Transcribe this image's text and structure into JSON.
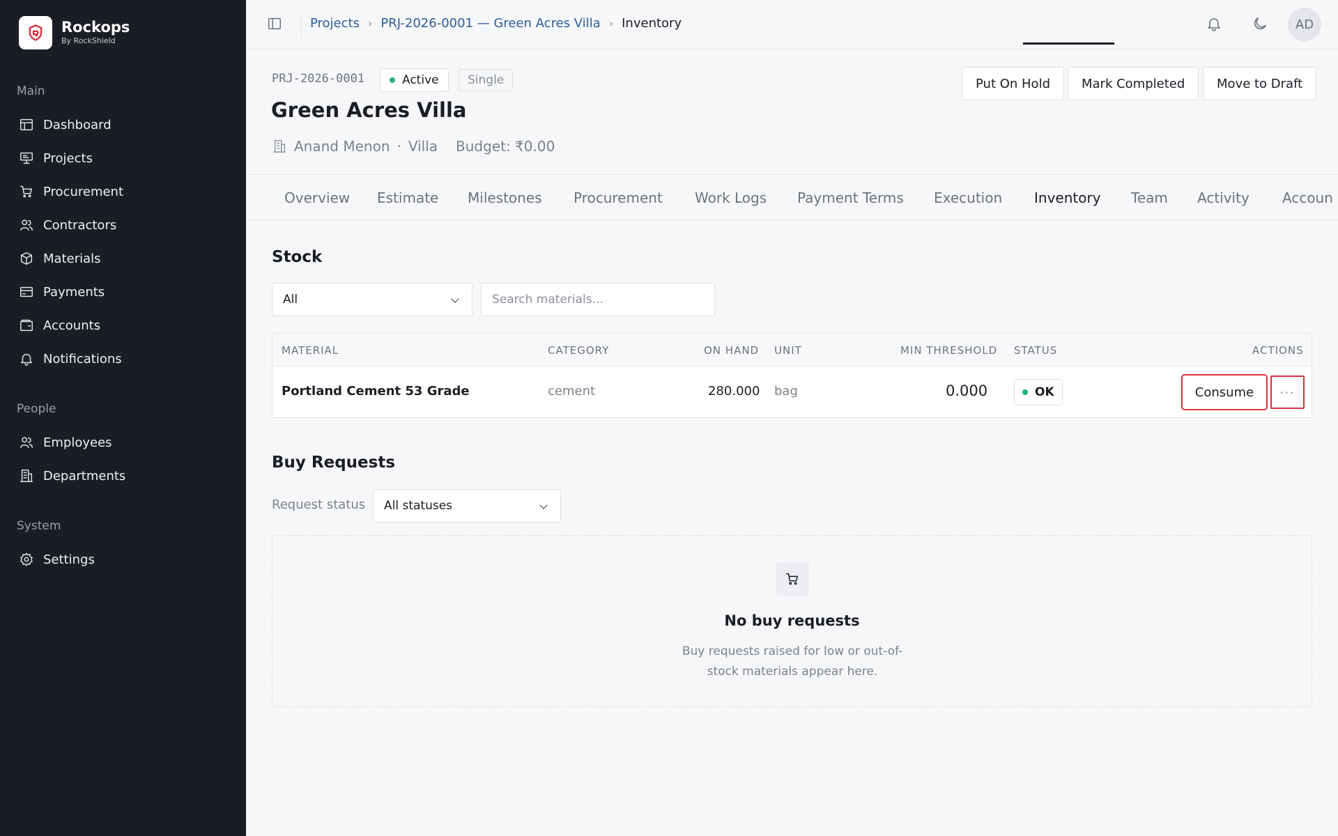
{
  "brand": {
    "name": "Rockops",
    "sub": "By RockShield"
  },
  "sidebar": {
    "sections": [
      {
        "label": "Main"
      },
      {
        "label": "People"
      },
      {
        "label": "System"
      }
    ],
    "items": [
      {
        "label": "Dashboard",
        "icon": "layout-icon"
      },
      {
        "label": "Projects",
        "icon": "presentation-icon"
      },
      {
        "label": "Procurement",
        "icon": "cart-icon"
      },
      {
        "label": "Contractors",
        "icon": "users-icon"
      },
      {
        "label": "Materials",
        "icon": "box-icon"
      },
      {
        "label": "Payments",
        "icon": "card-icon"
      },
      {
        "label": "Accounts",
        "icon": "wallet-icon"
      },
      {
        "label": "Notifications",
        "icon": "bell-icon"
      },
      {
        "label": "Employees",
        "icon": "users-icon"
      },
      {
        "label": "Departments",
        "icon": "building-icon"
      },
      {
        "label": "Settings",
        "icon": "gear-icon"
      }
    ]
  },
  "topbar": {
    "breadcrumb": [
      "Projects",
      "PRJ-2026-0001 — Green Acres Villa",
      "Inventory"
    ],
    "avatar": "AD"
  },
  "project": {
    "code": "PRJ-2026-0001",
    "status": "Active",
    "type": "Single",
    "title": "Green Acres Villa",
    "client": "Anand Menon",
    "category": "Villa",
    "budget": "Budget: ₹0.00",
    "actions": [
      "Put On Hold",
      "Mark Completed",
      "Move to Draft"
    ]
  },
  "tabs": [
    "Overview",
    "Estimate",
    "Milestones",
    "Procurement",
    "Work Logs",
    "Payment Terms",
    "Execution",
    "Inventory",
    "Team",
    "Activity",
    "Accoun"
  ],
  "active_tab": "Inventory",
  "stock": {
    "title": "Stock",
    "filter_value": "All",
    "search_placeholder": "Search materials...",
    "columns": [
      "MATERIAL",
      "CATEGORY",
      "ON HAND",
      "UNIT",
      "MIN THRESHOLD",
      "STATUS",
      "ACTIONS"
    ],
    "rows": [
      {
        "material": "Portland Cement 53 Grade",
        "category": "cement",
        "on_hand": "280.000",
        "unit": "bag",
        "min_threshold": "0.000",
        "status": "OK",
        "action": "Consume",
        "more": "···"
      }
    ]
  },
  "buy_requests": {
    "title": "Buy Requests",
    "filter_label": "Request status",
    "filter_value": "All statuses",
    "empty_title": "No buy requests",
    "empty_desc": "Buy requests raised for low or out-of-stock materials appear here."
  },
  "colors": {
    "sidebar_bg": "#1b1d24",
    "status_green": "#22b573",
    "link_blue": "#2d5d9a",
    "highlight_red": "#d3323c"
  }
}
